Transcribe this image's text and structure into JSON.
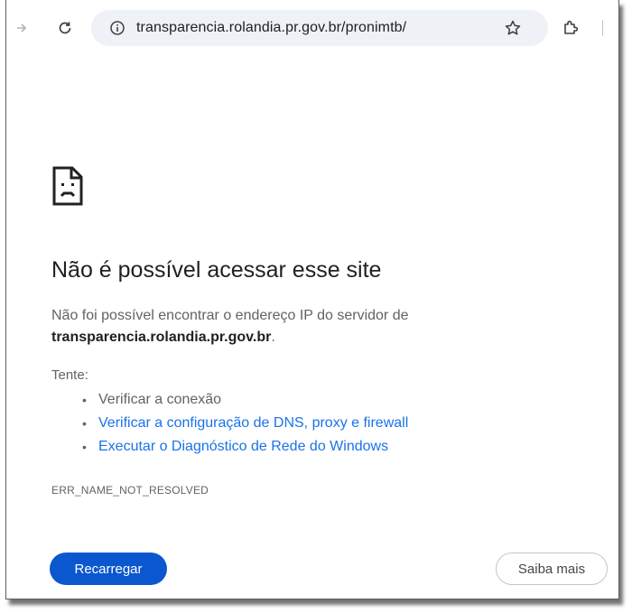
{
  "browser": {
    "url": "transparencia.rolandia.pr.gov.br/pronimtb/"
  },
  "error": {
    "title": "Não é possível acessar esse site",
    "description": "Não foi possível encontrar o endereço IP do servidor de",
    "host": "transparencia.rolandia.pr.gov.br",
    "host_suffix": ".",
    "try_label": "Tente:",
    "suggestions": [
      {
        "label": "Verificar a conexão",
        "link": false
      },
      {
        "label": "Verificar a configuração de DNS, proxy e firewall",
        "link": true
      },
      {
        "label": "Executar o Diagnóstico de Rede do Windows",
        "link": true
      }
    ],
    "code": "ERR_NAME_NOT_RESOLVED"
  },
  "buttons": {
    "reload": "Recarregar",
    "learn_more": "Saiba mais"
  },
  "colors": {
    "primary_button": "#0b57d0",
    "link": "#1a73e8",
    "omnibox_bg": "#eef1f6"
  }
}
